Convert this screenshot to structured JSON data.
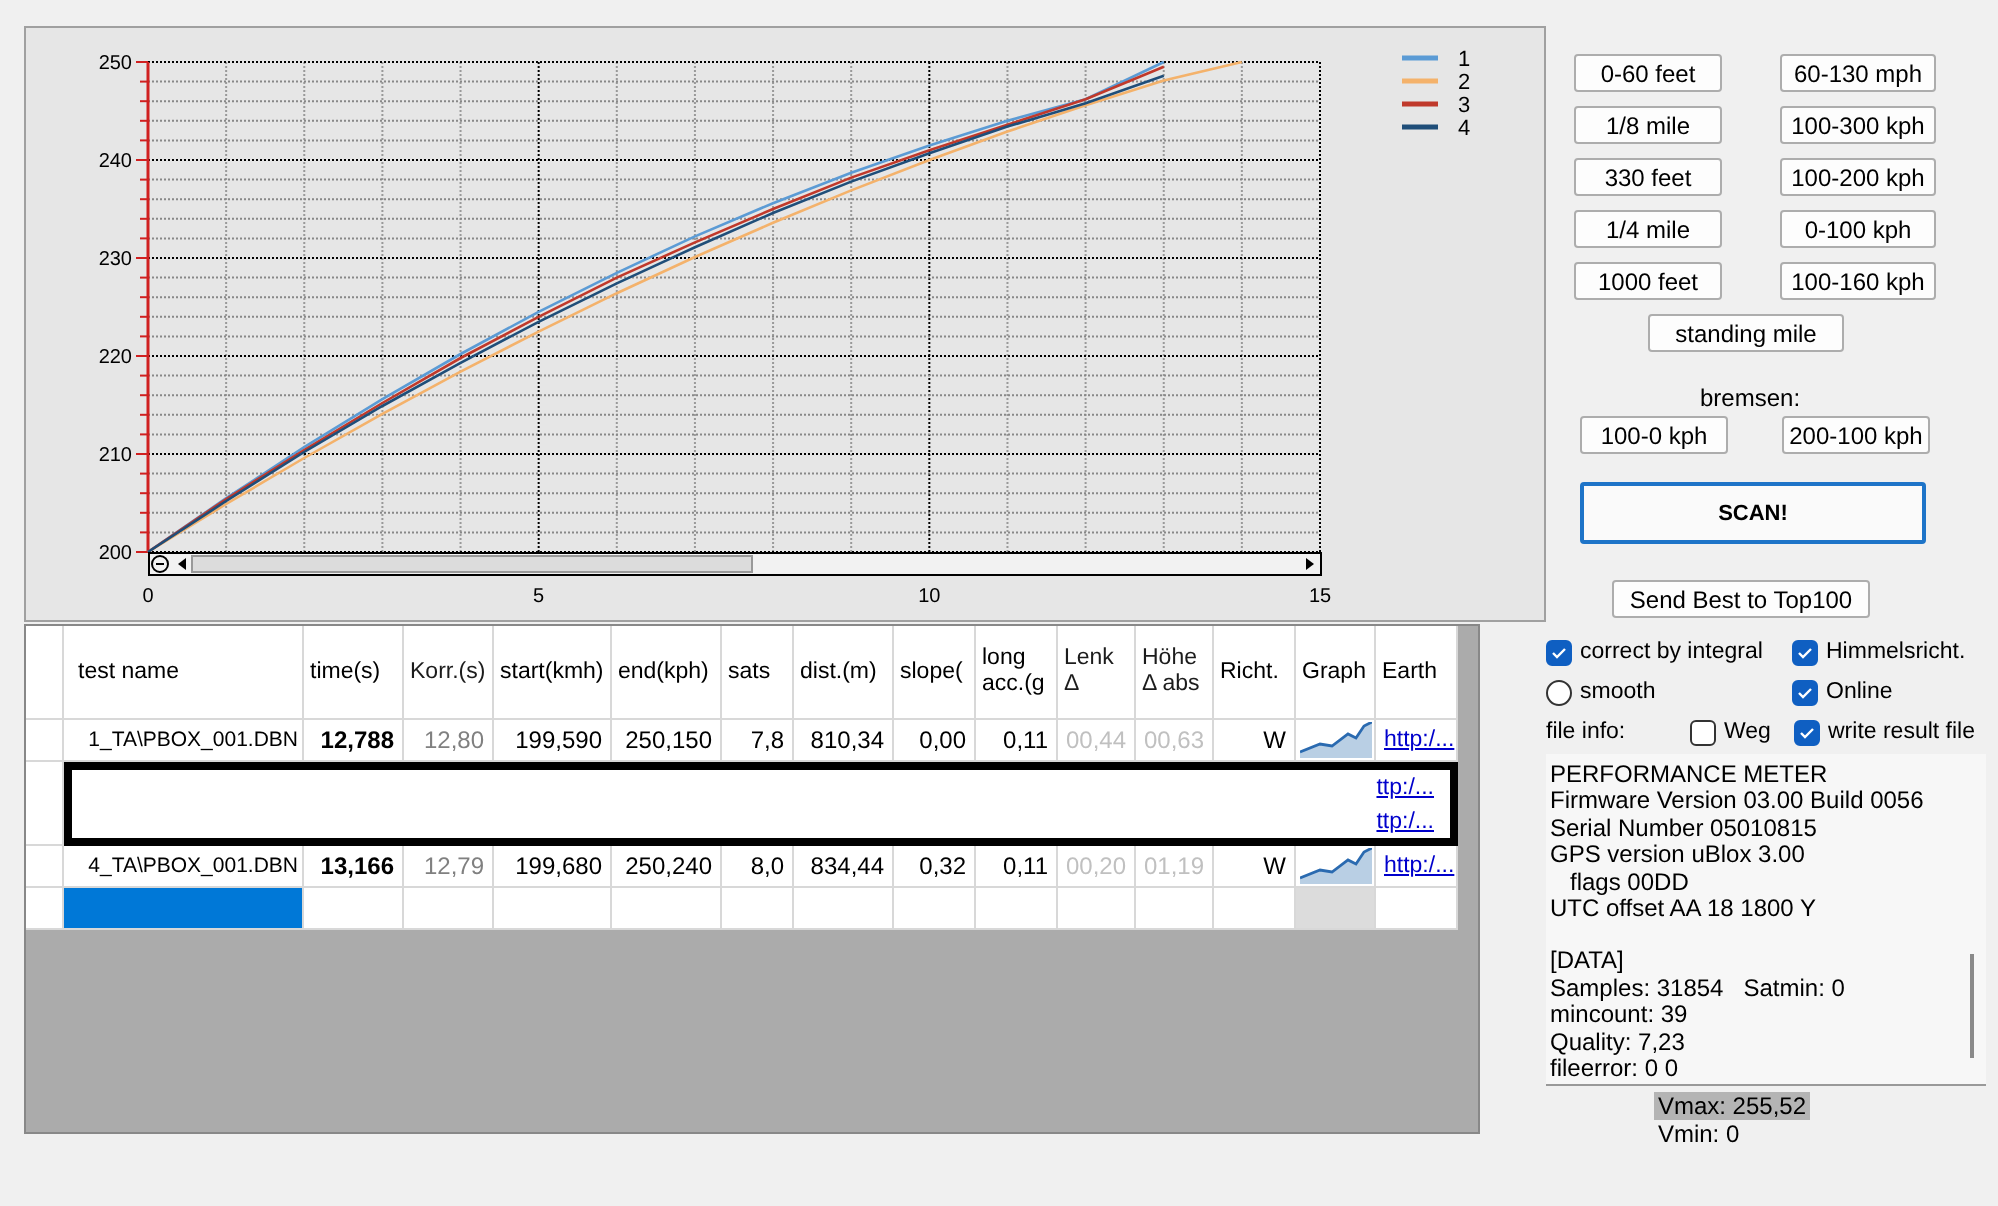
{
  "chart": {
    "chart_data": {
      "type": "line",
      "grid": true,
      "legend": true,
      "x": [
        0,
        1,
        2,
        3,
        4,
        5,
        6,
        7,
        8,
        9,
        10,
        11,
        12,
        13,
        14
      ],
      "xlim": [
        0,
        15
      ],
      "ylim": [
        200,
        250
      ],
      "xticks": [
        0,
        5,
        10,
        15
      ],
      "yticks": [
        200,
        210,
        220,
        230,
        240,
        250
      ],
      "series": [
        {
          "name": "1",
          "color": "#5b9bd5",
          "values": [
            200,
            205.5,
            210.7,
            215.6,
            220.2,
            224.5,
            228.5,
            232.2,
            235.6,
            238.7,
            241.5,
            244.0,
            246.2,
            250,
            null
          ]
        },
        {
          "name": "2",
          "color": "#f4b26b",
          "values": [
            200,
            204.9,
            209.6,
            214.1,
            218.4,
            222.5,
            226.4,
            230.1,
            233.6,
            236.9,
            240,
            242.9,
            245.6,
            248.1,
            250
          ]
        },
        {
          "name": "3",
          "color": "#c0392b",
          "values": [
            200,
            205.4,
            210.4,
            215.2,
            219.8,
            224,
            228,
            231.6,
            235,
            238.2,
            241,
            243.6,
            246.2,
            249.5,
            null
          ]
        },
        {
          "name": "4",
          "color": "#1f4e79",
          "values": [
            200,
            205.2,
            210.2,
            214.9,
            219.3,
            223.5,
            227.4,
            231.1,
            234.6,
            237.8,
            240.7,
            243.4,
            245.8,
            248.6,
            null
          ]
        }
      ]
    }
  },
  "buttons": {
    "left": [
      "0-60 feet",
      "1/8 mile",
      "330 feet",
      "1/4 mile",
      "1000 feet"
    ],
    "right": [
      "60-130 mph",
      "100-300 kph",
      "100-200 kph",
      "0-100 kph",
      "100-160 kph"
    ],
    "center": "standing mile",
    "brake_label": "bremsen:",
    "brake": [
      "100-0 kph",
      "200-100 kph"
    ],
    "scan": "SCAN!",
    "send": "Send Best to Top100"
  },
  "table": {
    "columns": [
      {
        "label": "test name",
        "dimmed": false
      },
      {
        "label": "time(s)",
        "dimmed": false
      },
      {
        "label": "Korr.(s)",
        "dimmed": true
      },
      {
        "label": "start(kmh)",
        "dimmed": false
      },
      {
        "label": "end(kph)",
        "dimmed": false
      },
      {
        "label": "sats",
        "dimmed": false
      },
      {
        "label": "dist.(m)",
        "dimmed": false
      },
      {
        "label": "slope(",
        "dimmed": false
      },
      {
        "label": "long acc.(g",
        "dimmed": false
      },
      {
        "label": "Lenk Δ",
        "dimmed": true
      },
      {
        "label": "Höhe Δ abs",
        "dimmed": true
      },
      {
        "label": "Richt.",
        "dimmed": false
      },
      {
        "label": "Graph",
        "dimmed": false
      },
      {
        "label": "Earth",
        "dimmed": false
      }
    ],
    "rows": [
      {
        "kind": "data",
        "selected": false,
        "cells": [
          "1_TA\\PBOX_001.DBN",
          "12,788",
          "12,80",
          "199,590",
          "250,150",
          "7,8",
          "810,34",
          "0,00",
          "0,11",
          "00,44",
          "00,63",
          "W"
        ],
        "earth": "http:/..."
      },
      {
        "kind": "redacted",
        "earth": "ttp:/..."
      },
      {
        "kind": "redacted",
        "earth": "ttp:/..."
      },
      {
        "kind": "data",
        "selected": false,
        "cells": [
          "4_TA\\PBOX_001.DBN",
          "13,166",
          "12,79",
          "199,680",
          "250,240",
          "8,0",
          "834,44",
          "0,32",
          "0,11",
          "00,20",
          "01,19",
          "W"
        ],
        "earth": "http:/..."
      },
      {
        "kind": "empty",
        "selected": true
      }
    ]
  },
  "options": [
    {
      "kind": "checkbox",
      "label": "correct by integral",
      "checked": true
    },
    {
      "kind": "checkbox",
      "label": "Himmelsricht.",
      "checked": true
    },
    {
      "kind": "radio",
      "label": "smooth",
      "checked": false
    },
    {
      "kind": "checkbox",
      "label": "Online",
      "checked": true
    },
    {
      "kind": "checkbox",
      "label": "Weg",
      "checked": false
    },
    {
      "kind": "checkbox",
      "label": "write result file",
      "checked": true
    }
  ],
  "file_info": {
    "label": "file info:",
    "paragraphs": [
      [
        "PERFORMANCE METER",
        "Firmware Version 03.00 Build 0056",
        "Serial Number 05010815",
        "GPS version uBlox 3.00",
        "   flags 00DD",
        "UTC offset AA 18 1800 Y"
      ],
      [
        "[DATA]",
        "Samples: 31854   Satmin: 0",
        "mincount: 39",
        "Quality: 7,23",
        "fileerror: 0 0"
      ]
    ]
  },
  "vmax": "Vmax: 255,52",
  "vmin": "Vmin: 0"
}
